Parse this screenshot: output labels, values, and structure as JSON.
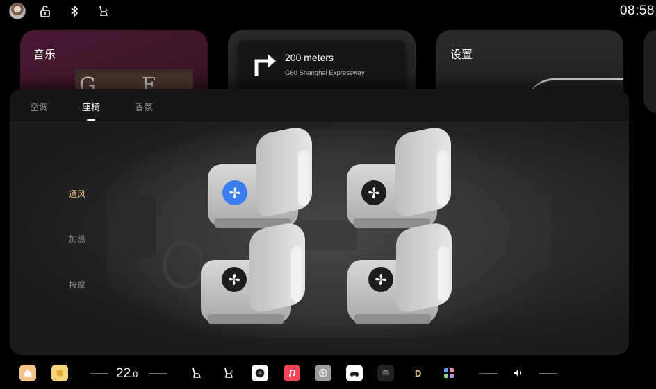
{
  "status_bar": {
    "time": "08:58",
    "icons": [
      "avatar",
      "unlock-icon",
      "bluetooth-icon",
      "seat-icon"
    ]
  },
  "cards": {
    "music": {
      "title": "音乐",
      "album_text": "G E M"
    },
    "navigation": {
      "distance": "200 meters",
      "road": "G60 Shanghai Expressway",
      "turn": "right-turn-arrow-icon"
    },
    "settings": {
      "title": "设置"
    }
  },
  "panel": {
    "tabs": [
      {
        "label": "空调",
        "active": false
      },
      {
        "label": "座椅",
        "active": true
      },
      {
        "label": "香氛",
        "active": false
      }
    ],
    "seat_options": [
      {
        "label": "通风",
        "active": true
      },
      {
        "label": "加热",
        "active": false
      },
      {
        "label": "按摩",
        "active": false
      }
    ],
    "seats": [
      {
        "name": "front-left",
        "ventilation_on": true
      },
      {
        "name": "front-right",
        "ventilation_on": false
      },
      {
        "name": "rear-left",
        "ventilation_on": false
      },
      {
        "name": "rear-right",
        "ventilation_on": false
      }
    ]
  },
  "dock": {
    "temperature": "22",
    "temperature_decimal": ".0",
    "apps": [
      "home-icon",
      "notes-icon",
      "seat-front-icon",
      "seat-rear-icon",
      "camera-icon",
      "music-icon",
      "browser-icon",
      "car-icon",
      "dashcam-icon",
      "d-app-icon",
      "apps-grid-icon"
    ],
    "volume_icon": "speaker-icon",
    "colors": {
      "accent_active": "#e8c084",
      "vent_on": "#3b7cf1"
    }
  }
}
